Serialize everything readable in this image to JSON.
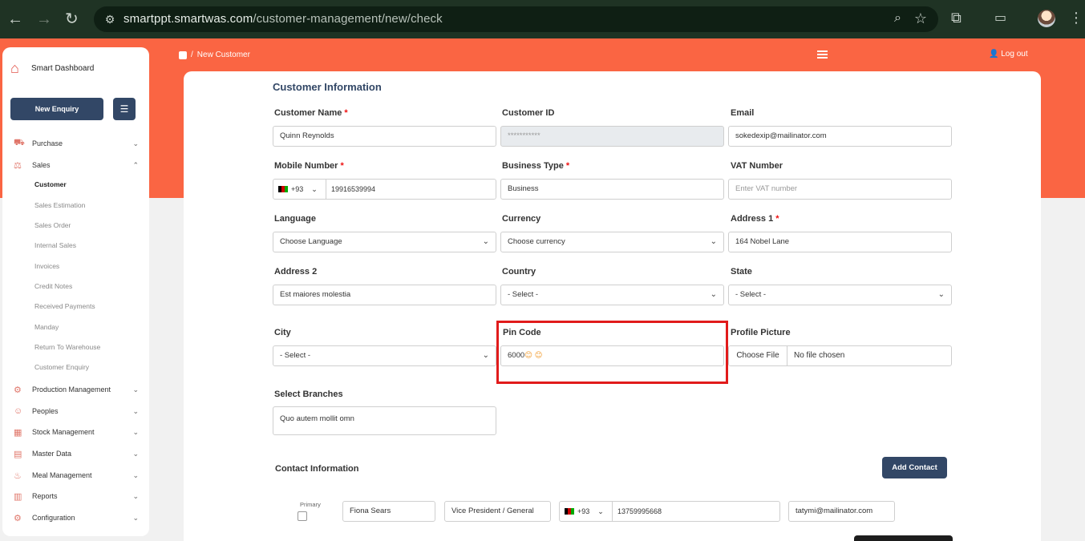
{
  "browser": {
    "url_host": "smartppt.smartwas.com",
    "url_path": "/customer-management/new/check"
  },
  "header": {
    "breadcrumb_separator": "/",
    "breadcrumb": "New Customer",
    "logout_label": "Log out"
  },
  "sidebar": {
    "brand": "Smart Dashboard",
    "new_enquiry_label": "New Enquiry",
    "menu": [
      {
        "label": "Purchase"
      },
      {
        "label": "Sales"
      },
      {
        "label": "Production Management"
      },
      {
        "label": "Peoples"
      },
      {
        "label": "Stock Management"
      },
      {
        "label": "Master Data"
      },
      {
        "label": "Meal Management"
      },
      {
        "label": "Reports"
      },
      {
        "label": "Configuration"
      }
    ],
    "sales_submenu": [
      "Customer",
      "Sales Estimation",
      "Sales Order",
      "Internal Sales",
      "Invoices",
      "Credit Notes",
      "Received Payments",
      "Manday",
      "Return To Warehouse",
      "Customer Enquiry"
    ]
  },
  "form": {
    "title": "Customer Information",
    "required_mark": "*",
    "customer_name": {
      "label": "Customer Name",
      "value": "Quinn Reynolds"
    },
    "customer_id": {
      "label": "Customer ID",
      "value": "***********"
    },
    "email": {
      "label": "Email",
      "value": "sokedexip@mailinator.com"
    },
    "mobile_number": {
      "label": "Mobile Number",
      "code": "+93",
      "value": "19916539994"
    },
    "business_type": {
      "label": "Business Type",
      "value": "Business"
    },
    "vat_number": {
      "label": "VAT Number",
      "placeholder": "Enter VAT number"
    },
    "language": {
      "label": "Language",
      "value": "Choose Language"
    },
    "currency": {
      "label": "Currency",
      "value": "Choose currency"
    },
    "address1": {
      "label": "Address 1",
      "value": "164 Nobel Lane"
    },
    "address2": {
      "label": "Address 2",
      "value": "Est maiores molestia"
    },
    "country": {
      "label": "Country",
      "value": "- Select -"
    },
    "state": {
      "label": "State",
      "value": "- Select -"
    },
    "city": {
      "label": "City",
      "value": "- Select -"
    },
    "pin_code": {
      "label": "Pin Code",
      "value": "6000",
      "emoji_suffix": "😊 😊"
    },
    "profile_picture": {
      "label": "Profile Picture",
      "button": "Choose File",
      "status": "No file chosen"
    },
    "select_branches": {
      "label": "Select Branches",
      "value": "Quo autem mollit omn"
    }
  },
  "contact": {
    "title": "Contact Information",
    "add_button": "Add Contact",
    "primary_label": "Primary",
    "name": "Fiona Sears",
    "designation": "Vice President / General",
    "phone_code": "+93",
    "phone": "13759995668",
    "email": "tatymi@mailinator.com"
  },
  "colors": {
    "accent": "#fa6543",
    "button": "#324766",
    "highlight": "#e11b1b"
  }
}
